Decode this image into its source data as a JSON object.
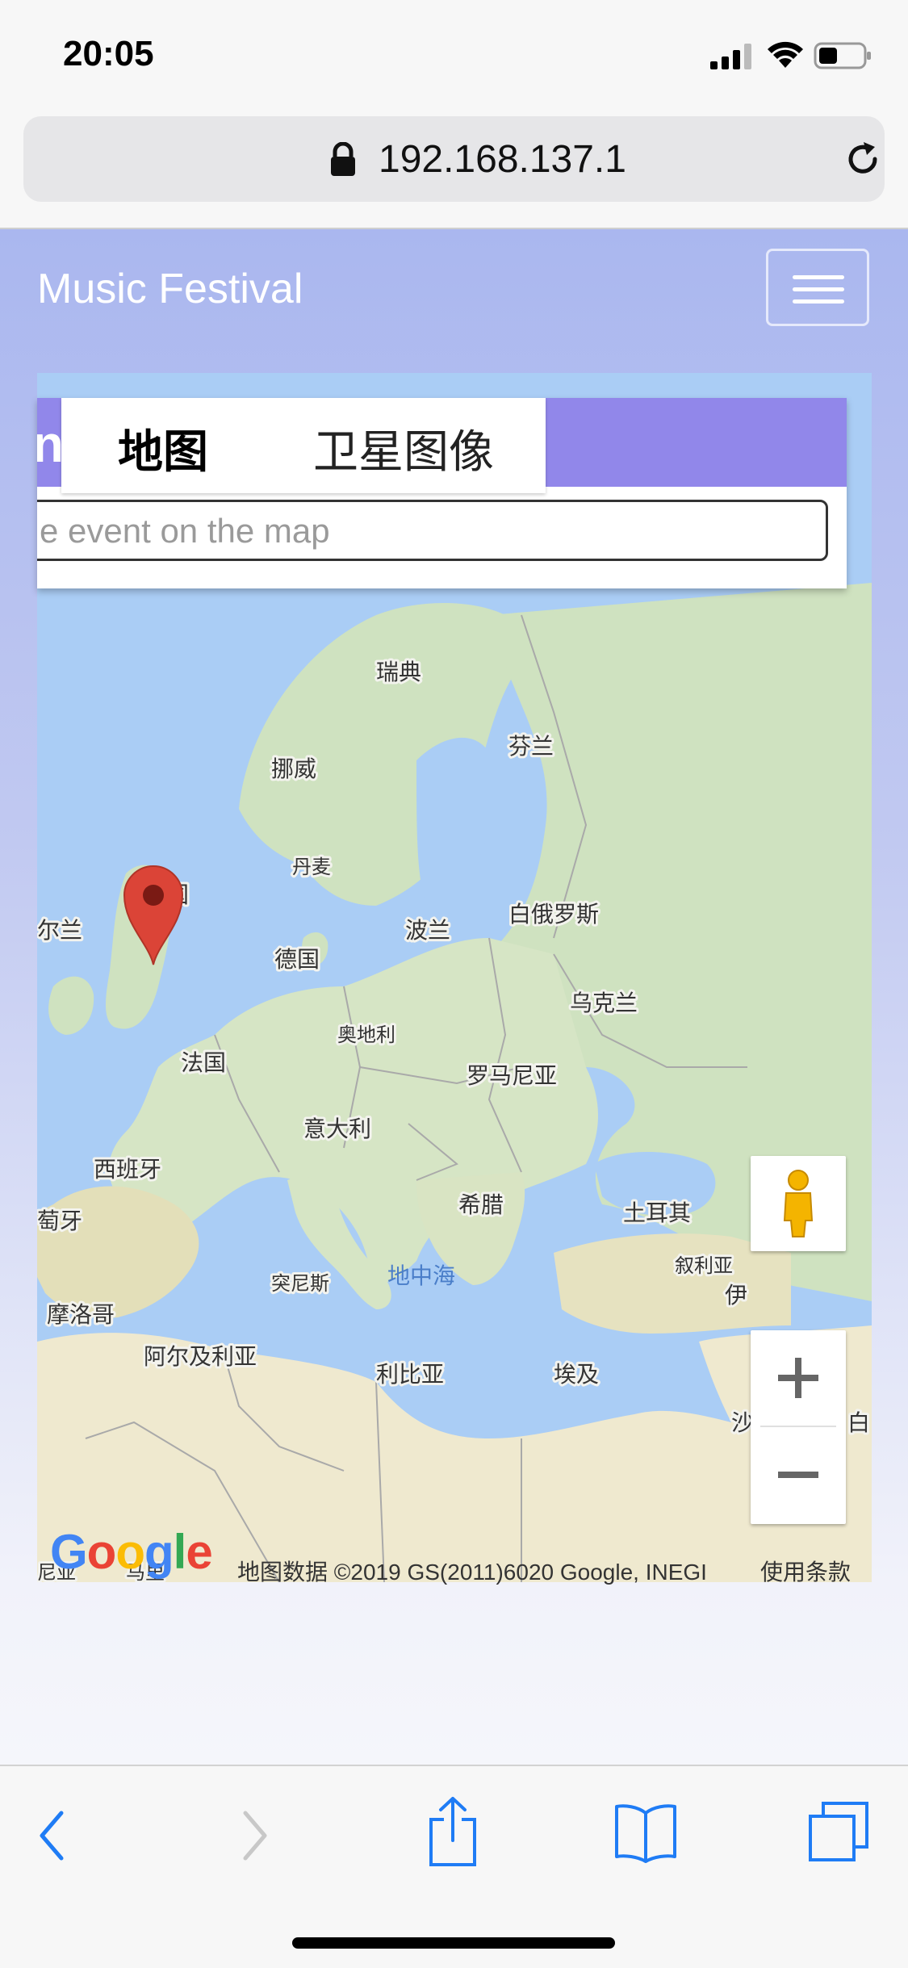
{
  "status_bar": {
    "time": "20:05"
  },
  "browser": {
    "url": "192.168.137.1"
  },
  "site": {
    "brand": "Music Festival",
    "menu_icon": "hamburger-icon"
  },
  "map": {
    "tabs": [
      {
        "label": "地图",
        "active": true
      },
      {
        "label": "卫星图像",
        "active": false
      }
    ],
    "cut_heading_letter": "n",
    "search_placeholder": "e event on the map",
    "labels": {
      "sweden": "瑞典",
      "finland": "芬兰",
      "norway": "挪威",
      "denmark": "丹麦",
      "uk": "国",
      "ireland": "尔兰",
      "belarus": "白俄罗斯",
      "poland": "波兰",
      "germany": "德国",
      "ukraine": "乌克兰",
      "austria": "奥地利",
      "france": "法国",
      "romania": "罗马尼亚",
      "italy": "意大利",
      "spain": "西班牙",
      "portugal": "萄牙",
      "greece": "希腊",
      "turkey": "土耳其",
      "tunisia": "突尼斯",
      "med_sea": "地中海",
      "syria": "叙利亚",
      "iran_partial": "伊",
      "morocco": "摩洛哥",
      "algeria": "阿尔及利亚",
      "libya": "利比亚",
      "egypt": "埃及",
      "saudi_partial": "沙",
      "saudi_partial2": "白",
      "bottom_left1": "尼亚",
      "bottom_left2": "马里"
    },
    "attribution": "地图数据 ©2019 GS(2011)6020 Google, INEGI",
    "terms": "使用条款",
    "logo_text": "Google",
    "marker_color": "#db4437",
    "accent_color": "#9187ea"
  },
  "toolbar": {
    "icons": [
      "back-chevron-icon",
      "forward-chevron-icon",
      "share-icon",
      "bookmarks-icon",
      "tabs-icon"
    ]
  }
}
